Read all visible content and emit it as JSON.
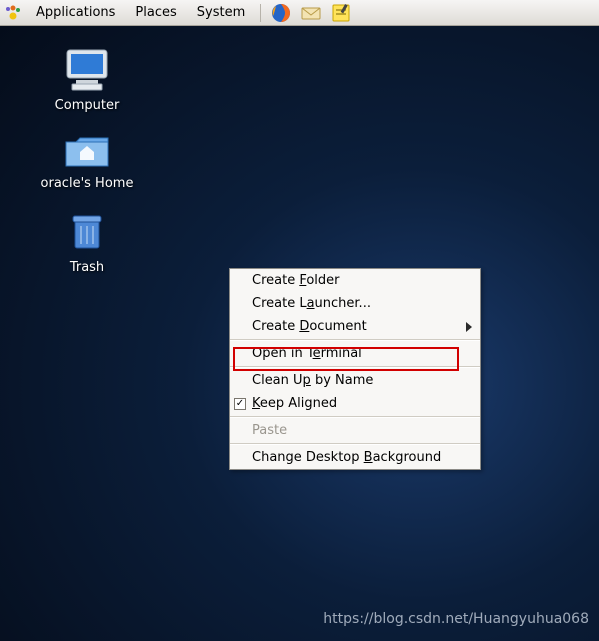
{
  "menubar": {
    "applications": "Applications",
    "places": "Places",
    "system": "System"
  },
  "icons": {
    "computer": {
      "label": "Computer"
    },
    "home": {
      "label": "oracle's Home"
    },
    "trash": {
      "label": "Trash"
    }
  },
  "context_menu": {
    "create_folder": {
      "pre": "Create ",
      "u": "F",
      "post": "older"
    },
    "create_launcher": {
      "pre": "Create L",
      "u": "a",
      "post": "uncher..."
    },
    "create_document": {
      "pre": "Create ",
      "u": "D",
      "post": "ocument"
    },
    "open_terminal": {
      "pre": "Open in T",
      "u": "e",
      "post": "rminal"
    },
    "clean_up": {
      "pre": "Clean U",
      "u": "p",
      "post": " by Name"
    },
    "keep_aligned": {
      "pre": "",
      "u": "K",
      "post": "eep Aligned",
      "checked": true
    },
    "paste": {
      "label": "Paste"
    },
    "change_bg": {
      "pre": "Change Desktop ",
      "u": "B",
      "post": "ackground"
    }
  },
  "watermark": "https://blog.csdn.net/Huangyuhua068"
}
